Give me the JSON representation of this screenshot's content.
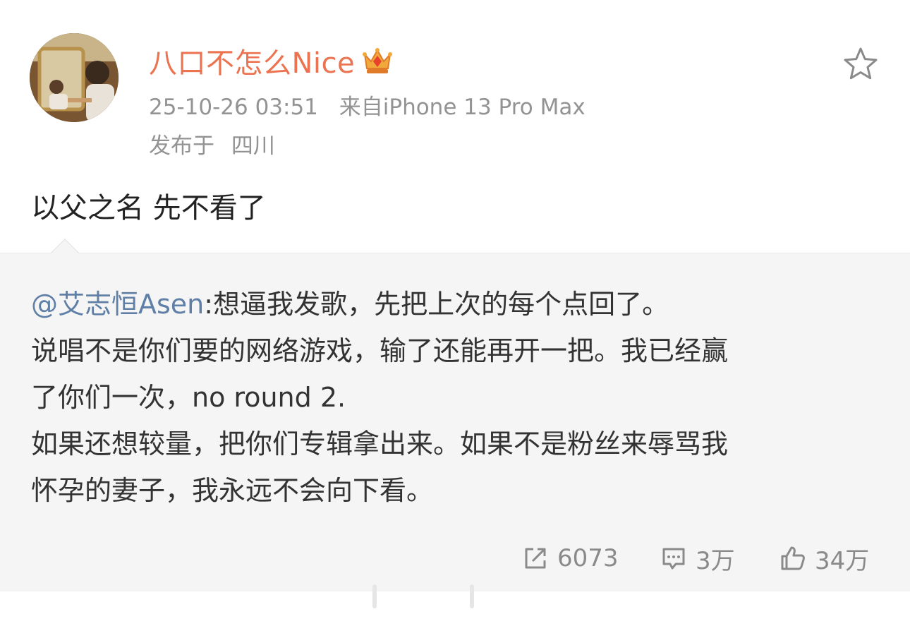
{
  "author": {
    "name": "八口不怎么Nice",
    "avatar_icon": "user-avatar",
    "badge_icon": "crown-icon",
    "name_color": "#eb7350"
  },
  "meta": {
    "datetime": "25-10-26 03:51",
    "source": "来自iPhone 13 Pro Max",
    "location_label": "发布于",
    "location": "四川"
  },
  "post": {
    "text": "以父之名 先不看了"
  },
  "retweet": {
    "mention": "@艾志恒Asen",
    "lines": [
      ":想逼我发歌，先把上次的每个点回了。",
      "说唱不是你们要的网络游戏，输了还能再开一把。我已经赢",
      "了你们一次，no round 2.",
      "如果还想较量，把你们专辑拿出来。如果不是粉丝来辱骂我",
      "怀孕的妻子，我永远不会向下看。"
    ],
    "mention_color": "#5f7fa6"
  },
  "actions": {
    "repost": {
      "icon": "repost-icon",
      "count": "6073"
    },
    "comment": {
      "icon": "comment-icon",
      "count": "3万"
    },
    "like": {
      "icon": "thumbs-up-icon",
      "count": "34万"
    }
  },
  "favorite_icon": "star-icon"
}
